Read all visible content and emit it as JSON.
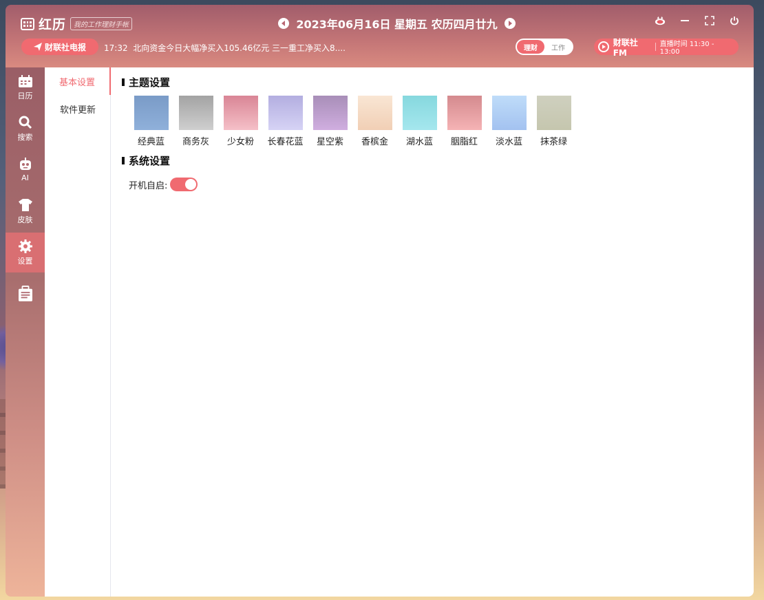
{
  "app": {
    "logo_text": "红历",
    "logo_tagline": "我的工作理财手帐"
  },
  "header": {
    "date": "2023年06月16日 星期五 农历四月廿九",
    "prev_icon": "caret-left-icon",
    "next_icon": "caret-right-icon",
    "window_controls": [
      "mascot-icon",
      "minimize-icon",
      "fullscreen-icon",
      "power-icon"
    ]
  },
  "news": {
    "badge_label": "财联社电报",
    "badge_icon": "paper-plane-icon",
    "time": "17:32",
    "headline": "北向资金今日大幅净买入105.46亿元 三一重工净买入8...."
  },
  "mode_toggle": {
    "options": [
      "理财",
      "工作"
    ],
    "active": "理财"
  },
  "fm": {
    "name": "财联社FM",
    "schedule": "直播时间 11:30 - 13:00"
  },
  "sidebar": {
    "items": [
      {
        "label": "日历",
        "icon": "calendar-icon"
      },
      {
        "label": "搜索",
        "icon": "search-icon"
      },
      {
        "label": "AI",
        "icon": "robot-icon"
      },
      {
        "label": "皮肤",
        "icon": "tshirt-icon"
      },
      {
        "label": "设置",
        "icon": "gear-icon"
      },
      {
        "label": "",
        "icon": "toolbox-icon"
      }
    ],
    "active": "设置"
  },
  "subnav": {
    "items": [
      "基本设置",
      "软件更新"
    ],
    "active": "基本设置"
  },
  "theme_section": {
    "title": "主题设置",
    "swatches": [
      {
        "label": "经典蓝",
        "color_top": "#7a9bc7",
        "color_bottom": "#8fb0da"
      },
      {
        "label": "商务灰",
        "color_top": "#a3a3a3",
        "color_bottom": "#cfcfcf"
      },
      {
        "label": "少女粉",
        "color_top": "#d98595",
        "color_bottom": "#f5c0c8"
      },
      {
        "label": "长春花蓝",
        "color_top": "#b3aee0",
        "color_bottom": "#d6d3f5"
      },
      {
        "label": "星空紫",
        "color_top": "#a88eb8",
        "color_bottom": "#d0aee0"
      },
      {
        "label": "香槟金",
        "color_top": "#f9e6d4",
        "color_bottom": "#f1cfb5"
      },
      {
        "label": "湖水蓝",
        "color_top": "#86d8de",
        "color_bottom": "#a5e7ee"
      },
      {
        "label": "胭脂红",
        "color_top": "#d48a8e",
        "color_bottom": "#f5b3b5"
      },
      {
        "label": "淡水蓝",
        "color_top": "#bfdcf9",
        "color_bottom": "#a3c2f0"
      },
      {
        "label": "抹茶绿",
        "color_top": "#cfd0bf",
        "color_bottom": "#c5c6ae"
      }
    ]
  },
  "system_section": {
    "title": "系统设置",
    "startup_label": "开机自启:",
    "startup_enabled": true
  },
  "colors": {
    "accent": "#f06a70",
    "header_top": "#a15d6b",
    "header_bottom": "#d98a80"
  }
}
